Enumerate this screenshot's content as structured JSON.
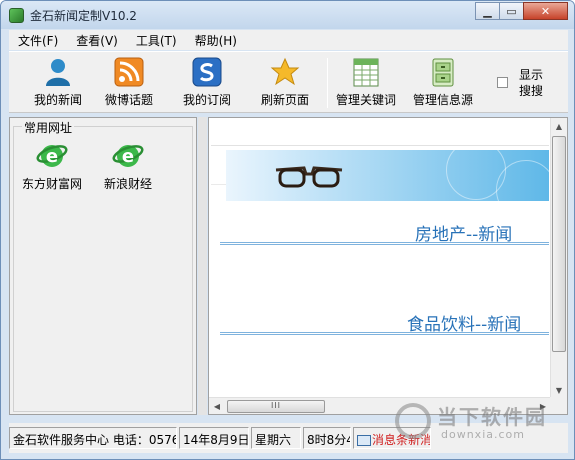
{
  "window": {
    "title": "金石新闻定制V10.2"
  },
  "menu": [
    {
      "label": "文件(F)"
    },
    {
      "label": "查看(V)"
    },
    {
      "label": "工具(T)"
    },
    {
      "label": "帮助(H)"
    }
  ],
  "toolbar": {
    "buttons": [
      {
        "label": "我的新闻",
        "icon": "user-icon"
      },
      {
        "label": "微博话题",
        "icon": "rss-icon"
      },
      {
        "label": "我的订阅",
        "icon": "subscribe-icon"
      },
      {
        "label": "刷新页面",
        "icon": "star-refresh-icon"
      },
      {
        "label": "管理关键词",
        "icon": "spreadsheet-icon"
      },
      {
        "label": "管理信息源",
        "icon": "cabinet-icon"
      }
    ],
    "show_search": {
      "label": "显示搜搜",
      "checked": false
    }
  },
  "left_panel": {
    "group_title": "常用网址",
    "sites": [
      {
        "label": "东方财富网",
        "icon": "ie-icon"
      },
      {
        "label": "新浪财经",
        "icon": "ie-icon"
      }
    ]
  },
  "content": {
    "sections": [
      {
        "heading": "房地产--新闻"
      },
      {
        "heading": "食品饮料--新闻"
      }
    ],
    "hscroll_grip": "III"
  },
  "status": {
    "service": "金石软件服务中心 电话：0576",
    "date": "14年8月9日",
    "weekday": "星期六",
    "time": "8时8分4",
    "alert": "消息条新消"
  },
  "watermark": {
    "title": "当下软件园",
    "url": "downxia.com"
  },
  "colors": {
    "title_bg": "#c2d6ec",
    "heading": "#2872b8",
    "alert": "#d02020"
  }
}
